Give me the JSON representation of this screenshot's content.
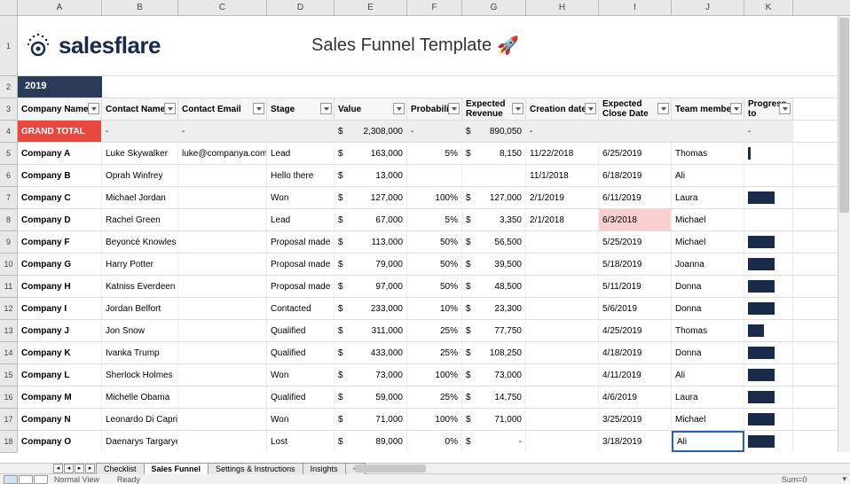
{
  "columns": [
    "A",
    "B",
    "C",
    "D",
    "E",
    "F",
    "G",
    "H",
    "I",
    "J",
    "K"
  ],
  "logo_text": "salesflare",
  "title": "Sales Funnel Template",
  "rocket": "🚀",
  "year": "2019",
  "headers": [
    "Company Name",
    "Contact Name",
    "Contact Email",
    "Stage",
    "Value",
    "Probability",
    "Expected Revenue",
    "Creation date",
    "Expected Close Date",
    "Team member",
    "Progress to"
  ],
  "grand_total_label": "GRAND TOTAL",
  "totals": {
    "value": "2,308,000",
    "expected": "890,050"
  },
  "dash": "-",
  "currency": "$",
  "rows": [
    {
      "company": "Company A",
      "contact": "Luke Skywalker",
      "email": "luke@companya.com",
      "stage": "Lead",
      "value": "163,000",
      "prob": "5%",
      "expected": "8,150",
      "created": "11/22/2018",
      "close": "6/25/2019",
      "member": "Thomas",
      "bar": "thin"
    },
    {
      "company": "Company B",
      "contact": "Oprah Winfrey",
      "email": "",
      "stage": "Hello there",
      "value": "13,000",
      "prob": "",
      "expected": "",
      "created": "11/1/2018",
      "close": "6/18/2019",
      "member": "Ali",
      "bar": ""
    },
    {
      "company": "Company C",
      "contact": "Michael Jordan",
      "email": "",
      "stage": "Won",
      "value": "127,000",
      "prob": "100%",
      "expected": "127,000",
      "created": "2/1/2019",
      "close": "6/11/2019",
      "member": "Laura",
      "bar": "full"
    },
    {
      "company": "Company D",
      "contact": "Rachel Green",
      "email": "",
      "stage": "Lead",
      "value": "67,000",
      "prob": "5%",
      "expected": "3,350",
      "created": "2/1/2018",
      "close": "6/3/2018",
      "close_red": true,
      "member": "Michael",
      "bar": ""
    },
    {
      "company": "Company F",
      "contact": "Beyoncé Knowles",
      "email": "",
      "stage": "Proposal made",
      "value": "113,000",
      "prob": "50%",
      "expected": "56,500",
      "created": "",
      "close": "5/25/2019",
      "member": "Michael",
      "bar": "full"
    },
    {
      "company": "Company G",
      "contact": "Harry Potter",
      "email": "",
      "stage": "Proposal made",
      "value": "79,000",
      "prob": "50%",
      "expected": "39,500",
      "created": "",
      "close": "5/18/2019",
      "member": "Joanna",
      "bar": "full"
    },
    {
      "company": "Company H",
      "contact": "Katniss Everdeen",
      "email": "",
      "stage": "Proposal made",
      "value": "97,000",
      "prob": "50%",
      "expected": "48,500",
      "created": "",
      "close": "5/11/2019",
      "member": "Donna",
      "bar": "full"
    },
    {
      "company": "Company I",
      "contact": "Jordan Belfort",
      "email": "",
      "stage": "Contacted",
      "value": "233,000",
      "prob": "10%",
      "expected": "23,300",
      "created": "",
      "close": "5/6/2019",
      "member": "Donna",
      "bar": "full"
    },
    {
      "company": "Company J",
      "contact": "Jon Snow",
      "email": "",
      "stage": "Qualified",
      "value": "311,000",
      "prob": "25%",
      "expected": "77,750",
      "created": "",
      "close": "4/25/2019",
      "member": "Thomas",
      "bar": "med"
    },
    {
      "company": "Company K",
      "contact": "Ivanka Trump",
      "email": "",
      "stage": "Qualified",
      "value": "433,000",
      "prob": "25%",
      "expected": "108,250",
      "created": "",
      "close": "4/18/2019",
      "member": "Donna",
      "bar": "full"
    },
    {
      "company": "Company L",
      "contact": "Sherlock Holmes",
      "email": "",
      "stage": "Won",
      "value": "73,000",
      "prob": "100%",
      "expected": "73,000",
      "created": "",
      "close": "4/11/2019",
      "member": "Ali",
      "bar": "full"
    },
    {
      "company": "Company M",
      "contact": "Michelle Obama",
      "email": "",
      "stage": "Qualified",
      "value": "59,000",
      "prob": "25%",
      "expected": "14,750",
      "created": "",
      "close": "4/6/2019",
      "member": "Laura",
      "bar": "full"
    },
    {
      "company": "Company N",
      "contact": "Leonardo Di Caprio",
      "email": "",
      "stage": "Won",
      "value": "71,000",
      "prob": "100%",
      "expected": "71,000",
      "created": "",
      "close": "3/25/2019",
      "member": "Michael",
      "bar": "full"
    },
    {
      "company": "Company O",
      "contact": "Daenarys Targaryen",
      "email": "",
      "stage": "Lost",
      "value": "89,000",
      "prob": "0%",
      "expected": "-",
      "expected_dash": true,
      "created": "",
      "close": "3/18/2019",
      "member": "Ali",
      "selected": true,
      "bar": "full"
    }
  ],
  "sheet_tabs": [
    "Checklist",
    "Sales Funnel",
    "Settings & Instructions",
    "Insights"
  ],
  "active_tab": 1,
  "status": {
    "view": "Normal View",
    "ready": "Ready",
    "sum": "Sum=0"
  }
}
